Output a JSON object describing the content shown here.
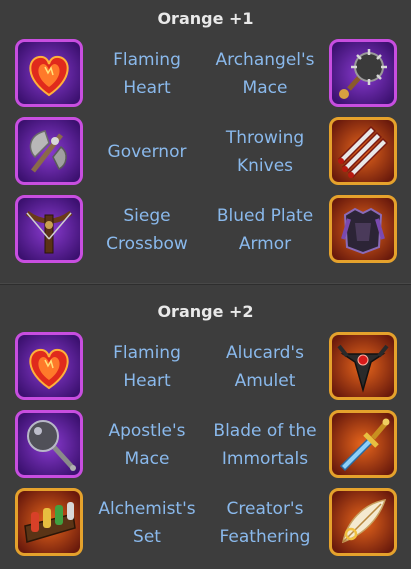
{
  "sections": [
    {
      "title": "Orange +1",
      "rows": [
        {
          "left": {
            "name": "Flaming Heart",
            "icon": "flaming-heart-icon",
            "frame": "purple"
          },
          "right": {
            "name": "Archangel's Mace",
            "icon": "archangels-mace-icon",
            "frame": "purple"
          }
        },
        {
          "left": {
            "name": "Governor",
            "icon": "governor-icon",
            "frame": "purple"
          },
          "right": {
            "name": "Throwing Knives",
            "icon": "throwing-knives-icon",
            "frame": "orange"
          }
        },
        {
          "left": {
            "name": "Siege Crossbow",
            "icon": "siege-crossbow-icon",
            "frame": "purple"
          },
          "right": {
            "name": "Blued Plate Armor",
            "icon": "blued-plate-armor-icon",
            "frame": "orange"
          }
        }
      ]
    },
    {
      "title": "Orange +2",
      "rows": [
        {
          "left": {
            "name": "Flaming Heart",
            "icon": "flaming-heart-icon",
            "frame": "purple"
          },
          "right": {
            "name": "Alucard's Amulet",
            "icon": "alucards-amulet-icon",
            "frame": "orange"
          }
        },
        {
          "left": {
            "name": "Apostle's Mace",
            "icon": "apostles-mace-icon",
            "frame": "purple"
          },
          "right": {
            "name": "Blade of the Immortals",
            "icon": "blade-of-the-immortals-icon",
            "frame": "orange"
          }
        },
        {
          "left": {
            "name": "Alchemist's Set",
            "icon": "alchemists-set-icon",
            "frame": "orange"
          },
          "right": {
            "name": "Creator's Feathering",
            "icon": "creators-feathering-icon",
            "frame": "orange"
          }
        }
      ]
    }
  ],
  "colors": {
    "background": "#3d3d3d",
    "title": "#e9e9e9",
    "item_name": "#8ab9ec",
    "purple_frame": "#c84ee0",
    "orange_frame": "#e5a22c"
  }
}
